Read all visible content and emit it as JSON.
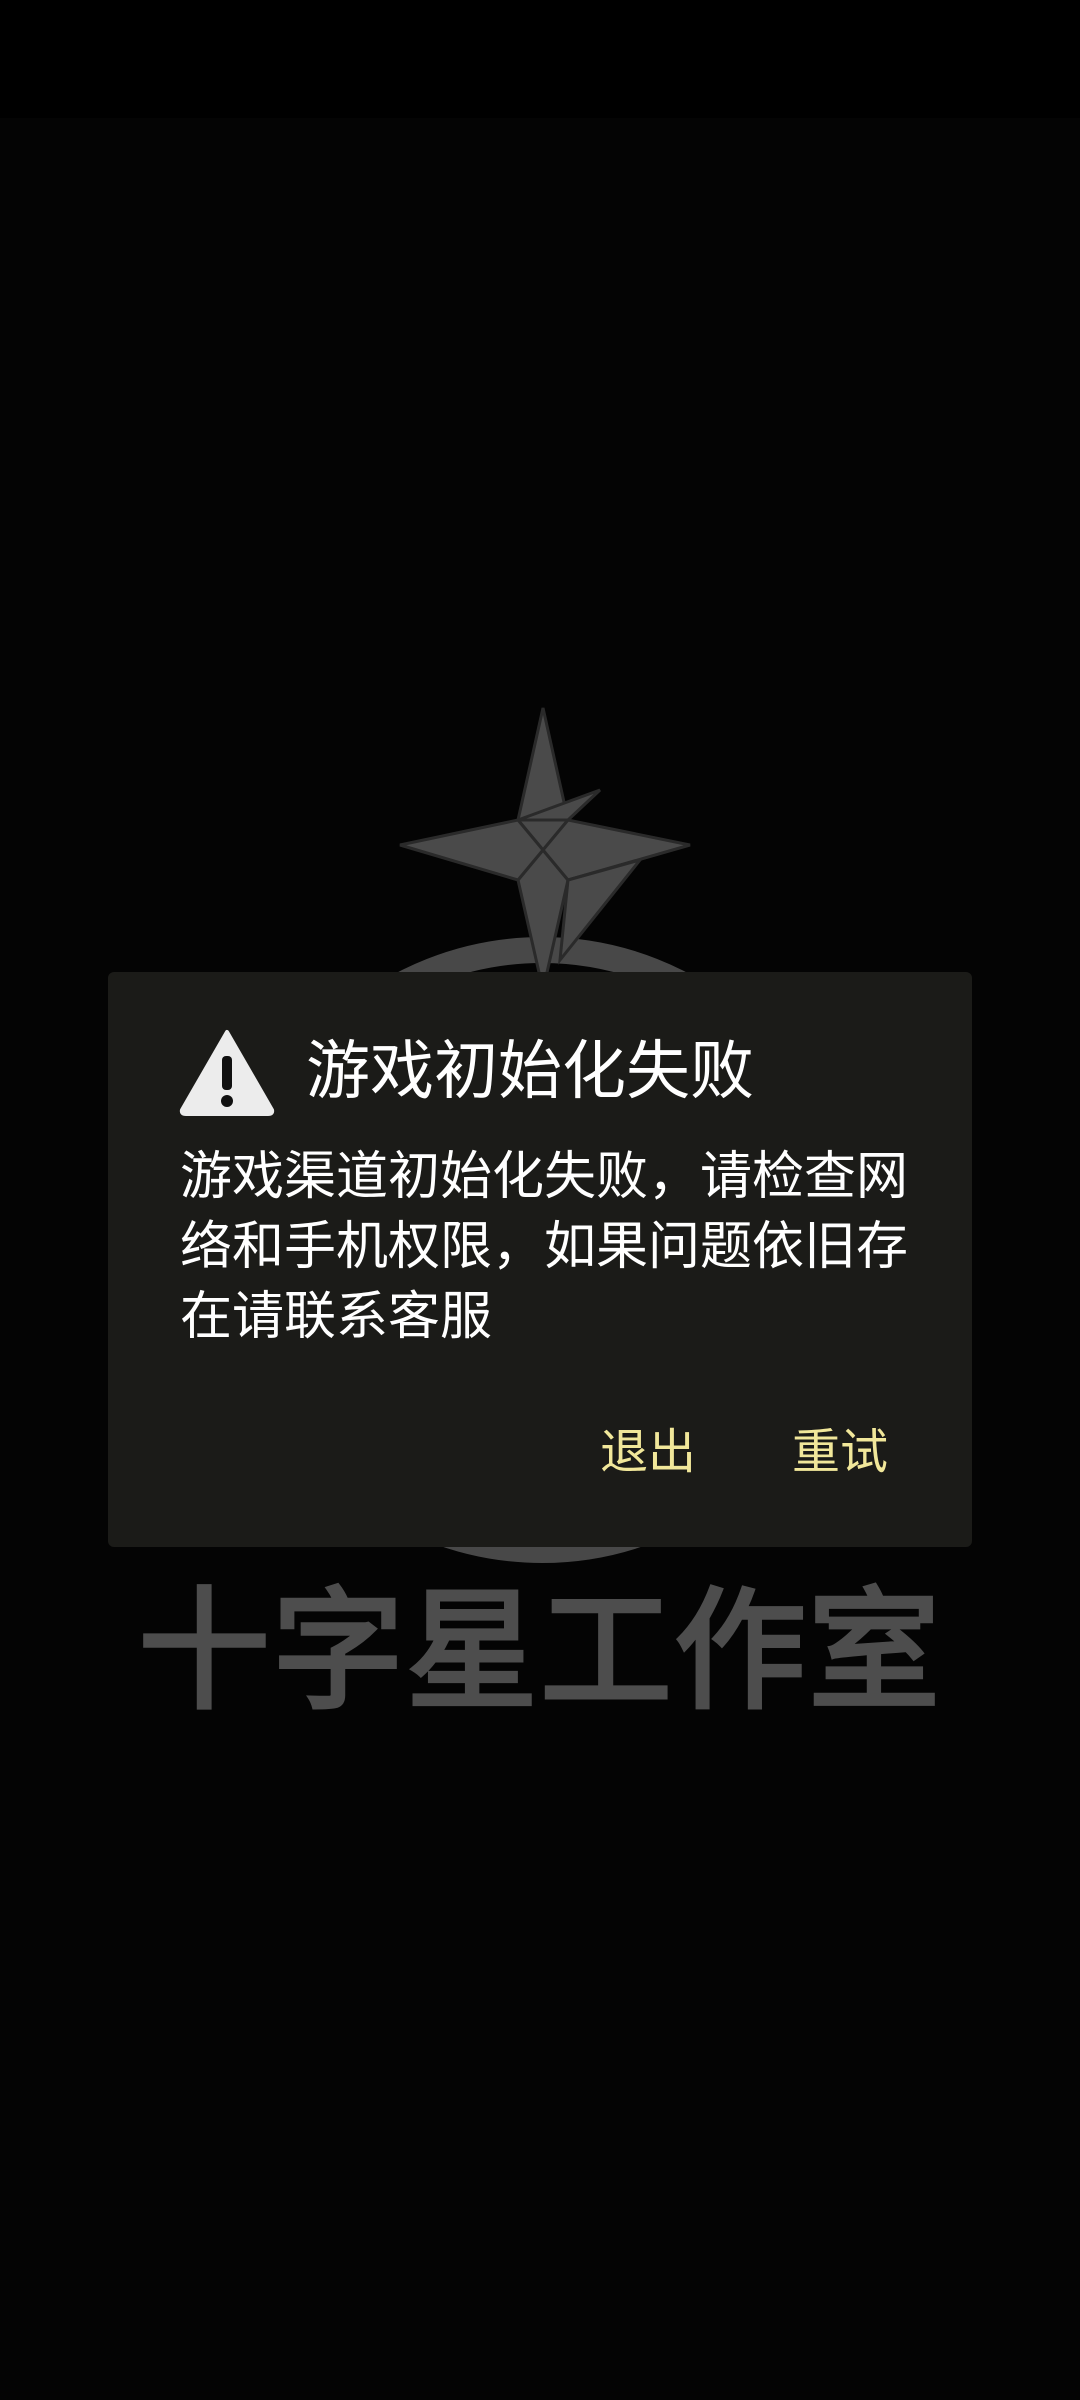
{
  "splash": {
    "studio_name": "十字星工作室",
    "logo_color": "#4a4a4a"
  },
  "dialog": {
    "icon": "warning-icon",
    "title": "游戏初始化失败",
    "message": "游戏渠道初始化失败，请检查网络和手机权限，如果问题依旧存在请联系客服",
    "buttons": {
      "exit_label": "退出",
      "retry_label": "重试"
    },
    "background_color": "#1b1b18",
    "button_color": "#f1e79a"
  }
}
